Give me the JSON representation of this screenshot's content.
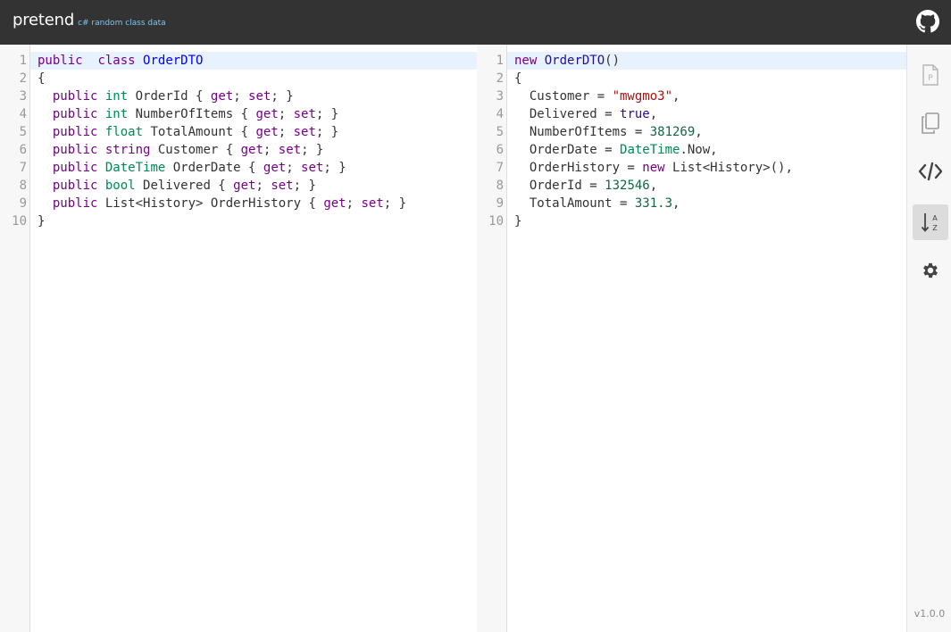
{
  "header": {
    "brand": "pretend",
    "tagline": "c# random class data",
    "github_icon": "github-icon"
  },
  "left_editor": {
    "lines": [
      {
        "n": "1",
        "segments": [
          [
            "kw",
            "public"
          ],
          [
            "",
            "  "
          ],
          [
            "kw",
            "class"
          ],
          [
            "",
            " "
          ],
          [
            "def",
            "OrderDTO"
          ]
        ]
      },
      {
        "n": "2",
        "segments": [
          [
            "",
            "{"
          ]
        ]
      },
      {
        "n": "3",
        "segments": [
          [
            "",
            "  "
          ],
          [
            "kw",
            "public"
          ],
          [
            "",
            " "
          ],
          [
            "ty",
            "int"
          ],
          [
            "",
            " OrderId { "
          ],
          [
            "kw",
            "get"
          ],
          [
            "",
            "; "
          ],
          [
            "kw",
            "set"
          ],
          [
            "",
            "; }"
          ]
        ]
      },
      {
        "n": "4",
        "segments": [
          [
            "",
            "  "
          ],
          [
            "kw",
            "public"
          ],
          [
            "",
            " "
          ],
          [
            "ty",
            "int"
          ],
          [
            "",
            " NumberOfItems { "
          ],
          [
            "kw",
            "get"
          ],
          [
            "",
            "; "
          ],
          [
            "kw",
            "set"
          ],
          [
            "",
            "; }"
          ]
        ]
      },
      {
        "n": "5",
        "segments": [
          [
            "",
            "  "
          ],
          [
            "kw",
            "public"
          ],
          [
            "",
            " "
          ],
          [
            "ty",
            "float"
          ],
          [
            "",
            " TotalAmount { "
          ],
          [
            "kw",
            "get"
          ],
          [
            "",
            "; "
          ],
          [
            "kw",
            "set"
          ],
          [
            "",
            "; }"
          ]
        ]
      },
      {
        "n": "6",
        "segments": [
          [
            "",
            "  "
          ],
          [
            "kw",
            "public"
          ],
          [
            "",
            " "
          ],
          [
            "kw",
            "string"
          ],
          [
            "",
            " Customer { "
          ],
          [
            "kw",
            "get"
          ],
          [
            "",
            "; "
          ],
          [
            "kw",
            "set"
          ],
          [
            "",
            "; }"
          ]
        ]
      },
      {
        "n": "7",
        "segments": [
          [
            "",
            "  "
          ],
          [
            "kw",
            "public"
          ],
          [
            "",
            " "
          ],
          [
            "ty",
            "DateTime"
          ],
          [
            "",
            " OrderDate { "
          ],
          [
            "kw",
            "get"
          ],
          [
            "",
            "; "
          ],
          [
            "kw",
            "set"
          ],
          [
            "",
            "; }"
          ]
        ]
      },
      {
        "n": "8",
        "segments": [
          [
            "",
            "  "
          ],
          [
            "kw",
            "public"
          ],
          [
            "",
            " "
          ],
          [
            "ty",
            "bool"
          ],
          [
            "",
            " Delivered { "
          ],
          [
            "kw",
            "get"
          ],
          [
            "",
            "; "
          ],
          [
            "kw",
            "set"
          ],
          [
            "",
            "; }"
          ]
        ]
      },
      {
        "n": "9",
        "segments": [
          [
            "",
            "  "
          ],
          [
            "kw",
            "public"
          ],
          [
            "",
            " List<History> OrderHistory { "
          ],
          [
            "kw",
            "get"
          ],
          [
            "",
            "; "
          ],
          [
            "kw",
            "set"
          ],
          [
            "",
            "; }"
          ]
        ]
      },
      {
        "n": "10",
        "segments": [
          [
            "",
            "}"
          ]
        ]
      }
    ]
  },
  "right_editor": {
    "lines": [
      {
        "n": "1",
        "segments": [
          [
            "kw",
            "new"
          ],
          [
            "",
            " "
          ],
          [
            "at",
            "OrderDTO"
          ],
          [
            "",
            "()"
          ]
        ]
      },
      {
        "n": "2",
        "segments": [
          [
            "",
            "{"
          ]
        ]
      },
      {
        "n": "3",
        "segments": [
          [
            "",
            "  Customer = "
          ],
          [
            "st",
            "\"mwgmo3\""
          ],
          [
            "",
            ","
          ]
        ]
      },
      {
        "n": "4",
        "segments": [
          [
            "",
            "  Delivered = "
          ],
          [
            "at",
            "true"
          ],
          [
            "",
            ","
          ]
        ]
      },
      {
        "n": "5",
        "segments": [
          [
            "",
            "  NumberOfItems = "
          ],
          [
            "nu",
            "381269"
          ],
          [
            "",
            ","
          ]
        ]
      },
      {
        "n": "6",
        "segments": [
          [
            "",
            "  OrderDate = "
          ],
          [
            "ty",
            "DateTime"
          ],
          [
            "",
            ".Now,"
          ]
        ]
      },
      {
        "n": "7",
        "segments": [
          [
            "",
            "  OrderHistory = "
          ],
          [
            "kw",
            "new"
          ],
          [
            "",
            " List<History>(),"
          ]
        ]
      },
      {
        "n": "8",
        "segments": [
          [
            "",
            "  OrderId = "
          ],
          [
            "nu",
            "132546"
          ],
          [
            "",
            ","
          ]
        ]
      },
      {
        "n": "9",
        "segments": [
          [
            "",
            "  TotalAmount = "
          ],
          [
            "nu",
            "331.3"
          ],
          [
            "",
            ","
          ]
        ]
      },
      {
        "n": "10",
        "segments": [
          [
            "",
            "}"
          ]
        ]
      }
    ]
  },
  "sidebar": {
    "buttons": [
      {
        "icon": "file-p-icon",
        "active": false
      },
      {
        "icon": "copy-icon",
        "active": false
      },
      {
        "icon": "code-icon",
        "active": false
      },
      {
        "icon": "sort-az-icon",
        "active": true
      },
      {
        "icon": "gear-icon",
        "active": false
      }
    ],
    "version": "v1.0.0"
  },
  "colors": {
    "header_bg": "#333333",
    "tagline": "#7fc4f0",
    "keyword": "#770088",
    "type": "#008855",
    "string": "#aa1111",
    "number": "#116644",
    "active_line": "#e8f2ff"
  }
}
